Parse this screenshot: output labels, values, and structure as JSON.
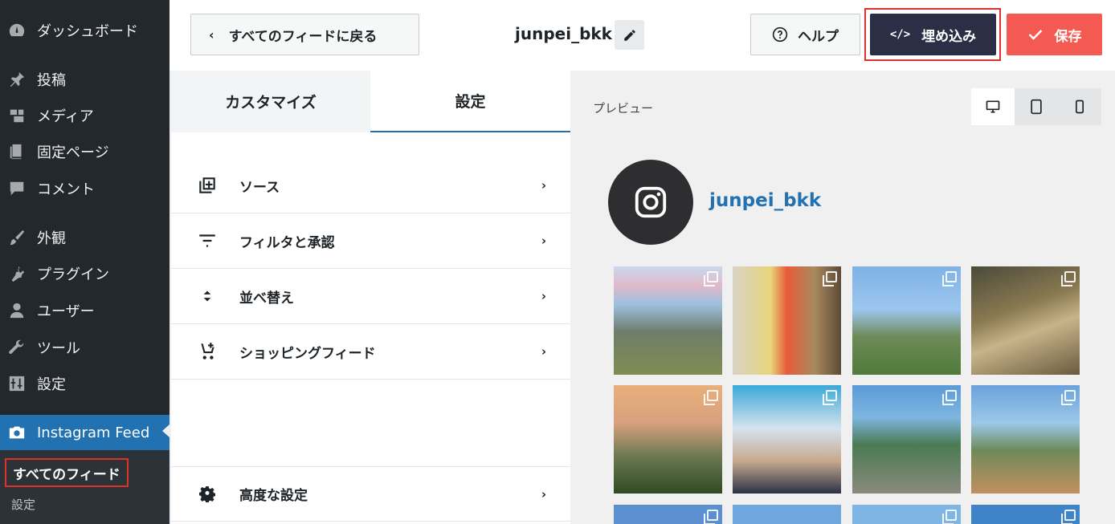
{
  "sidebar": {
    "items": [
      {
        "label": "ダッシュボード",
        "icon": "dashboard-icon"
      },
      {
        "label": "投稿",
        "icon": "pin-icon"
      },
      {
        "label": "メディア",
        "icon": "media-icon"
      },
      {
        "label": "固定ページ",
        "icon": "page-icon"
      },
      {
        "label": "コメント",
        "icon": "comment-icon"
      },
      {
        "label": "外観",
        "icon": "brush-icon"
      },
      {
        "label": "プラグイン",
        "icon": "plugin-icon"
      },
      {
        "label": "ユーザー",
        "icon": "user-icon"
      },
      {
        "label": "ツール",
        "icon": "wrench-icon"
      },
      {
        "label": "設定",
        "icon": "settings-icon"
      }
    ],
    "active": {
      "label": "Instagram Feed",
      "icon": "camera-icon"
    },
    "sub_items": {
      "current": "すべてのフィード",
      "settings": "設定"
    }
  },
  "header": {
    "back_label": "すべてのフィードに戻る",
    "feed_name": "junpei_bkk",
    "help_label": "ヘルプ",
    "embed_label": "埋め込み",
    "embed_code_glyph": "</>",
    "save_label": "保存"
  },
  "panel": {
    "tabs": [
      "カスタマイズ",
      "設定"
    ],
    "active_tab": "設定",
    "rows": [
      {
        "label": "ソース",
        "icon": "add-source-icon"
      },
      {
        "label": "フィルタと承認",
        "icon": "filter-icon"
      },
      {
        "label": "並べ替え",
        "icon": "sort-icon"
      },
      {
        "label": "ショッピングフィード",
        "icon": "cart-icon"
      }
    ],
    "advanced_label": "高度な設定",
    "chevron": "›"
  },
  "preview": {
    "label": "プレビュー",
    "devices": [
      "desktop-icon",
      "tablet-icon",
      "mobile-icon"
    ],
    "username": "junpei_bkk",
    "colors": {
      "accent": "#2271b1",
      "embed": "#2a2f45",
      "save": "#f55a52",
      "highlight": "#e0302a"
    }
  }
}
